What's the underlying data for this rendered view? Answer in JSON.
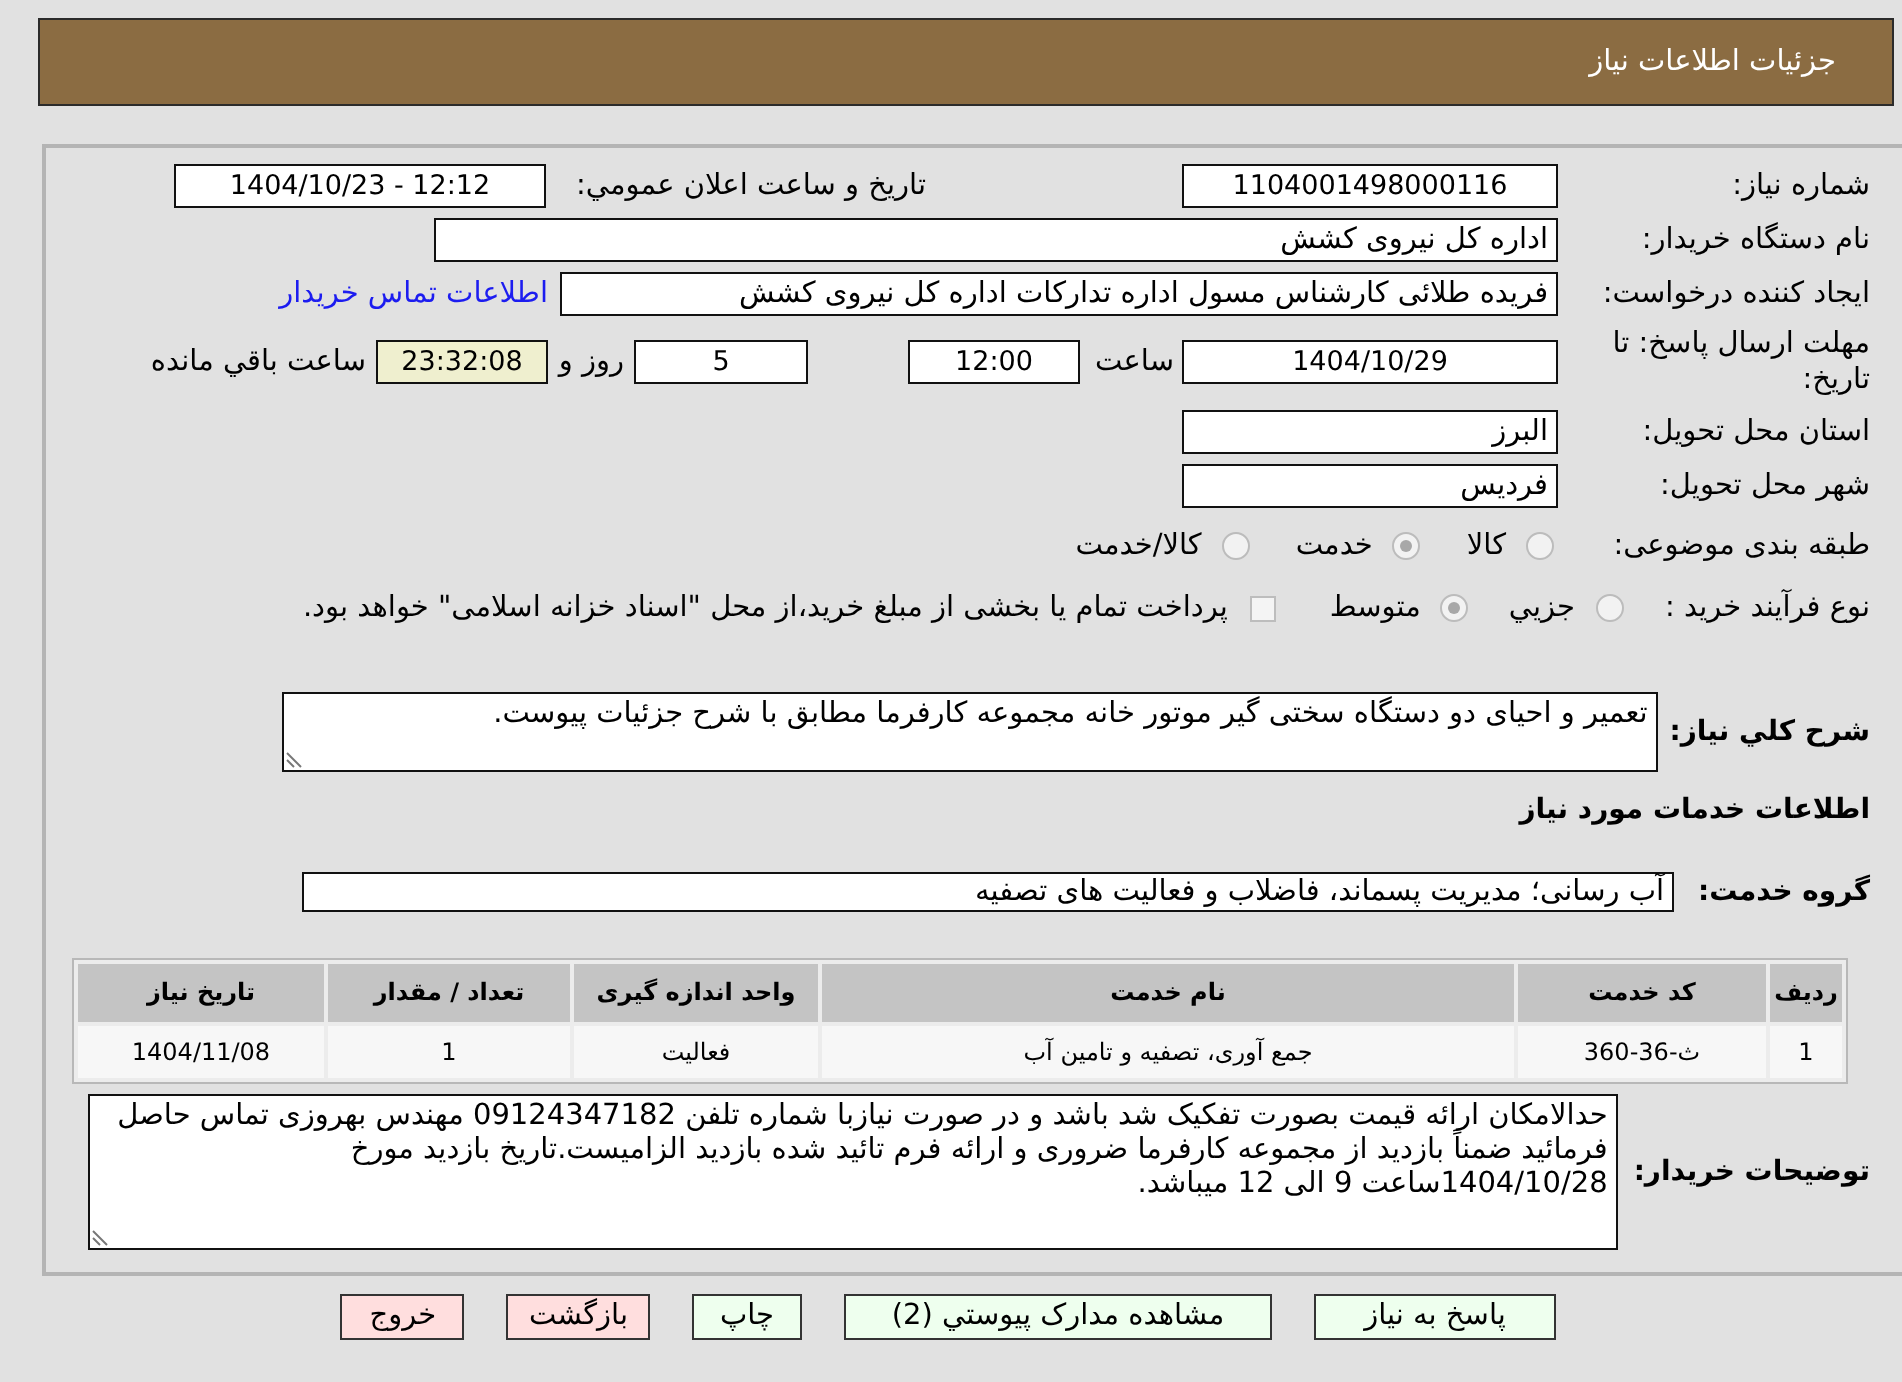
{
  "header": {
    "title": "جزئیات اطلاعات نیاز"
  },
  "need_number": {
    "label": "شماره نیاز:",
    "value": "1104001498000116"
  },
  "announce": {
    "label": "تاریخ و ساعت اعلان عمومي:",
    "value": "1404/10/23 - 12:12"
  },
  "buyer_org": {
    "label": "نام دستگاه خریدار:",
    "value": "اداره کل نیروی کشش"
  },
  "requester": {
    "label": "ایجاد کننده درخواست:",
    "value": "فریده طلائی کارشناس مسول اداره تدارکات اداره کل نیروی کشش",
    "contact_link": "اطلاعات تماس خریدار"
  },
  "deadline": {
    "label": "مهلت ارسال پاسخ: تا تاریخ:",
    "date": "1404/10/29",
    "time_label": "ساعت",
    "time": "12:00",
    "days": "5",
    "days_label": "روز و",
    "remaining": "23:32:08",
    "remaining_label": "ساعت باقي مانده"
  },
  "province": {
    "label": "استان محل تحویل:",
    "value": "البرز"
  },
  "city": {
    "label": "شهر محل تحویل:",
    "value": "فردیس"
  },
  "category": {
    "label": "طبقه بندی موضوعی:",
    "options": [
      {
        "label": "کالا",
        "selected": false
      },
      {
        "label": "خدمت",
        "selected": true
      },
      {
        "label": "کالا/خدمت",
        "selected": false
      }
    ]
  },
  "purchase_type": {
    "label": "نوع فرآیند خرید :",
    "options": [
      {
        "label": "جزيي",
        "selected": false
      },
      {
        "label": "متوسط",
        "selected": true
      }
    ],
    "treasury": {
      "label": "پرداخت تمام یا بخشی از مبلغ خرید،از محل \"اسناد خزانه اسلامی\" خواهد بود.",
      "checked": false
    }
  },
  "description": {
    "label": "شرح کلي نیاز:",
    "value": "تعمیر و احیای دو دستگاه سختی گیر موتور خانه مجموعه کارفرما مطابق با شرح جزئیات پیوست."
  },
  "services_heading": "اطلاعات خدمات مورد نیاز",
  "service_group": {
    "label": "گروه خدمت:",
    "value": "آب رسانی؛ مدیریت پسماند، فاضلاب و فعالیت های تصفیه"
  },
  "table": {
    "columns": [
      "ردیف",
      "کد خدمت",
      "نام خدمت",
      "واحد اندازه گیری",
      "تعداد / مقدار",
      "تاریخ نیاز"
    ],
    "rows": [
      [
        "1",
        "ث-36-360",
        "جمع آوری، تصفیه و تامین آب",
        "فعالیت",
        "1",
        "1404/11/08"
      ]
    ]
  },
  "buyer_notes": {
    "label": "توضیحات خریدار:",
    "value": "حدالامکان ارائه قیمت بصورت تفکیک شد باشد و در صورت نیازبا شماره تلفن 09124347182 مهندس بهروزی تماس حاصل فرمائید ضمناً بازدید از مجموعه کارفرما ضروری و ارائه فرم تائید شده بازدید الزامیست.تاریخ بازدید مورخ 1404/10/28ساعت 9 الی 12 میباشد."
  },
  "buttons": [
    {
      "label": "پاسخ به نیاز",
      "kind": "go"
    },
    {
      "label": "مشاهده مدارک پیوستي (2)",
      "kind": "go"
    },
    {
      "label": "چاپ",
      "kind": "go"
    },
    {
      "label": "بازگشت",
      "kind": "stop"
    },
    {
      "label": "خروج",
      "kind": "stop"
    }
  ]
}
